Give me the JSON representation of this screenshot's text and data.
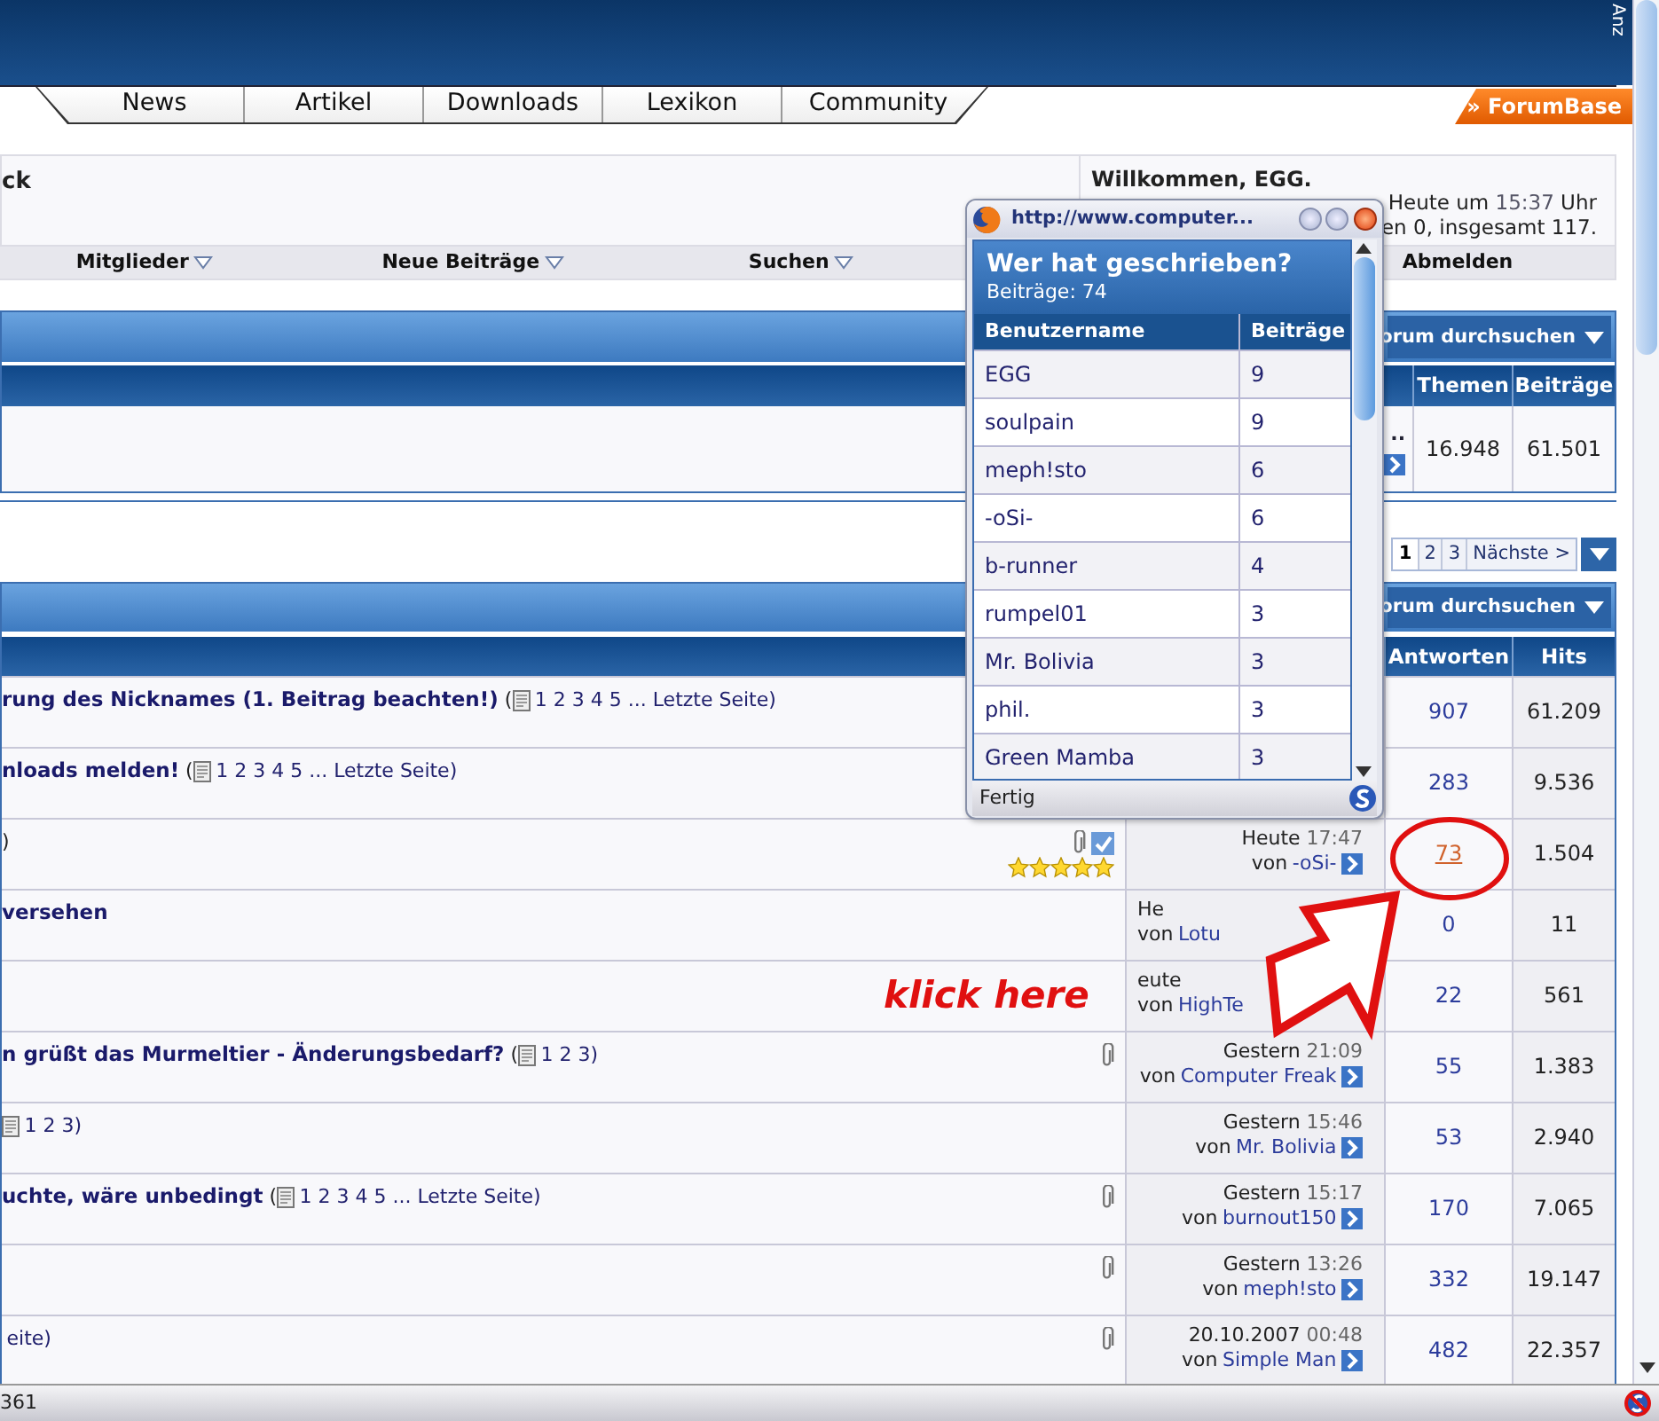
{
  "banner": {
    "side_text": "Anz"
  },
  "nav_tabs": [
    {
      "label": "News"
    },
    {
      "label": "Artikel"
    },
    {
      "label": "Downloads"
    },
    {
      "label": "Lexikon"
    },
    {
      "label": "Community"
    }
  ],
  "forumbase_tab": "» ForumBase",
  "welcome": {
    "left_text": "ck",
    "title": "Willkommen, EGG.",
    "line_1": {
      "text": "Heute um",
      "time": "15:37",
      "suffix": "Uhr"
    },
    "line_2": "en 0, insgesamt 117."
  },
  "menu": [
    {
      "label": "Mitglieder",
      "dropdown": true
    },
    {
      "label": "Neue Beiträge",
      "dropdown": true
    },
    {
      "label": "Suchen",
      "dropdown": true
    },
    {
      "label": "Abmelden",
      "dropdown": false
    }
  ],
  "forum_box": {
    "search_label": "orum durchsuchen",
    "columns": [
      "Themen",
      "Beiträge"
    ],
    "row": {
      "cell_1": "..",
      "themen": "16.948",
      "beitraege": "61.501"
    }
  },
  "pagination": {
    "pages": [
      {
        "label": "1",
        "selected": true
      },
      {
        "label": "2",
        "selected": false
      },
      {
        "label": "3",
        "selected": false
      }
    ],
    "next": "Nächste >"
  },
  "thread_box": {
    "search_label": "orum durchsuchen",
    "columns": [
      "Antworten",
      "Hits"
    ],
    "rows": [
      {
        "title": "**rung des Nicknames (1. Beitrag beachten!)** (",
        "pages_icon": true,
        "pages": "1 2 3 4 5 ... Letzte Seite)",
        "attachment": false,
        "marked": false,
        "replies": "907",
        "replies_highlighted": false,
        "hits": "61.209"
      },
      {
        "title": "**nloads melden!** (",
        "pages_icon": true,
        "pages": "1 2 3 4 5 ... Letzte Seite)",
        "attachment": false,
        "marked": false,
        "replies": "283",
        "replies_highlighted": false,
        "hits": "9.536"
      },
      {
        "title": ")",
        "pages_icon": false,
        "attachment": true,
        "marked": true,
        "stars": 5,
        "last_post": {
          "date": "Heute",
          "time": "17:47",
          "by": "von",
          "author": "-oSi-",
          "go_icon": true
        },
        "replies": "73",
        "replies_highlighted": true,
        "hits": "1.504"
      },
      {
        "title": "**versehen**",
        "pages_icon": false,
        "attachment": false,
        "marked": false,
        "last_post": {
          "date": "He",
          "by": "von",
          "author": "Lotu",
          "go_icon": false,
          "obscured": true
        },
        "replies": "0",
        "replies_highlighted": false,
        "hits": "11"
      },
      {
        "pages_icon": false,
        "attachment": false,
        "marked": false,
        "last_post": {
          "date": "eute",
          "by": "von",
          "author": "HighTe",
          "go_icon": false,
          "obscured": true
        },
        "replies": "22",
        "replies_highlighted": false,
        "hits": "561"
      },
      {
        "title": "**n grüßt das Murmeltier - Änderungsbedarf?** (",
        "pages_icon": true,
        "pages": "1 2 3)",
        "attachment": true,
        "marked": false,
        "last_post": {
          "date": "Gestern",
          "time": "21:09",
          "by": "von",
          "author": "Computer Freak",
          "go_icon": true
        },
        "replies": "55",
        "replies_highlighted": false,
        "hits": "1.383"
      },
      {
        "pages_icon": true,
        "pages": "1 2 3)",
        "attachment": false,
        "marked": false,
        "last_post": {
          "date": "Gestern",
          "time": "15:46",
          "by": "von",
          "author": "Mr. Bolivia",
          "go_icon": true
        },
        "replies": "53",
        "replies_highlighted": false,
        "hits": "2.940"
      },
      {
        "title": "**uchte, wäre unbedingt** (",
        "pages_icon": true,
        "pages": "1 2 3 4 5 ... Letzte Seite)",
        "attachment": true,
        "marked": false,
        "last_post": {
          "date": "Gestern",
          "time": "15:17",
          "by": "von",
          "author": "burnout150",
          "go_icon": true
        },
        "replies": "170",
        "replies_highlighted": false,
        "hits": "7.065"
      },
      {
        "pages_icon": false,
        "attachment": true,
        "marked": false,
        "last_post": {
          "date": "Gestern",
          "time": "13:26",
          "by": "von",
          "author": "meph!sto",
          "go_icon": true
        },
        "replies": "332",
        "replies_highlighted": false,
        "hits": "19.147"
      },
      {
        "pages_icon": false,
        "pages": "eite)",
        "attachment": true,
        "marked": false,
        "last_post": {
          "date": "20.10.2007",
          "time": "00:48",
          "by": "von",
          "author": "Simple Man",
          "go_icon": true
        },
        "replies": "482",
        "replies_highlighted": false,
        "hits": "22.357"
      }
    ]
  },
  "annotation": {
    "text": "klick here"
  },
  "popup": {
    "url": "http://www.computer...",
    "title": "Wer hat geschrieben?",
    "subtitle": "Beiträge: 74",
    "columns": [
      "Benutzername",
      "Beiträge"
    ],
    "rows": [
      {
        "name": "EGG",
        "count": "9"
      },
      {
        "name": "soulpain",
        "count": "9"
      },
      {
        "name": "meph!sto",
        "count": "6"
      },
      {
        "name": "-oSi-",
        "count": "6"
      },
      {
        "name": "b-runner",
        "count": "4"
      },
      {
        "name": "rumpel01",
        "count": "3"
      },
      {
        "name": "Mr. Bolivia",
        "count": "3"
      },
      {
        "name": "phil.",
        "count": "3"
      },
      {
        "name": "Green Mamba",
        "count": "3"
      }
    ],
    "status": "Fertig"
  },
  "status_bar": {
    "text": "361"
  }
}
